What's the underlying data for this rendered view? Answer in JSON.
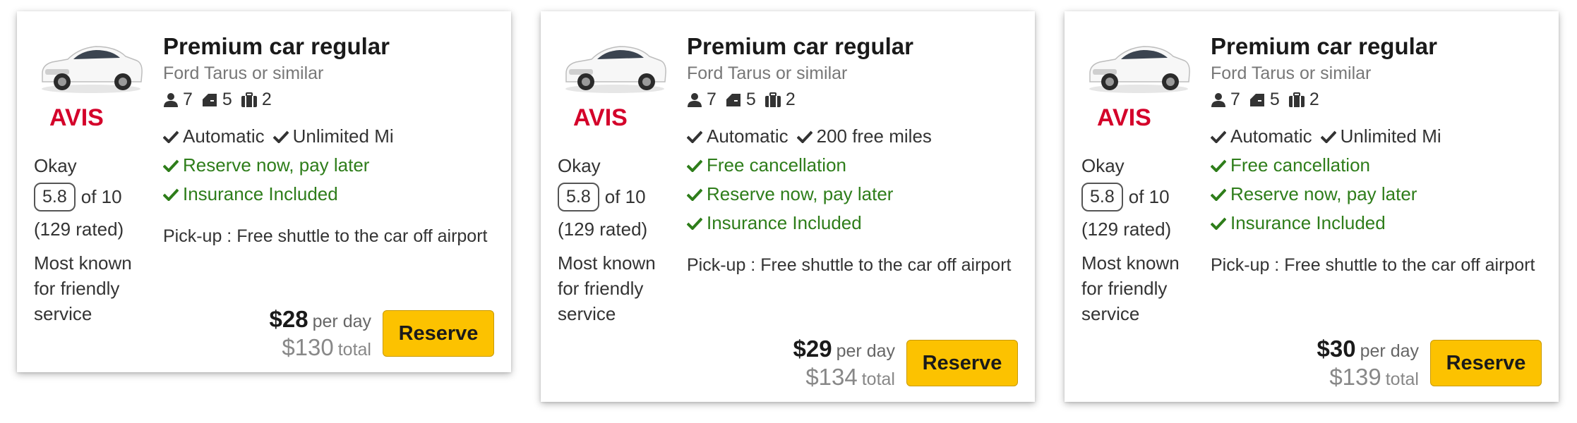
{
  "brand": {
    "logo_text": "AVIS",
    "logo_color": "#d4002a"
  },
  "colors": {
    "reserve_bg": "#fcc200",
    "green_text": "#2e7d1a"
  },
  "cards": [
    {
      "title": "Premium car regular",
      "subtitle": "Ford Tarus or similar",
      "specs": {
        "passengers": "7",
        "doors": "5",
        "bags": "2"
      },
      "features": [
        "Automatic",
        "Unlimited Mi"
      ],
      "green_features": [
        "Reserve now, pay later",
        "Insurance Included"
      ],
      "rating": {
        "word": "Okay",
        "score": "5.8",
        "out_of": "of 10",
        "rated": "(129 rated)",
        "known": "Most known for friendly service"
      },
      "pickup": "Pick-up : Free shuttle to the car off airport",
      "price": {
        "per_day": "$28",
        "per_day_label": "per day",
        "total": "$130",
        "total_label": "total"
      },
      "reserve_label": "Reserve"
    },
    {
      "title": "Premium car regular",
      "subtitle": "Ford Tarus or similar",
      "specs": {
        "passengers": "7",
        "doors": "5",
        "bags": "2"
      },
      "features": [
        "Automatic",
        "200 free miles"
      ],
      "green_features": [
        "Free cancellation",
        "Reserve now, pay later",
        "Insurance Included"
      ],
      "rating": {
        "word": "Okay",
        "score": "5.8",
        "out_of": "of 10",
        "rated": "(129 rated)",
        "known": "Most known for friendly service"
      },
      "pickup": "Pick-up : Free shuttle to the car off airport",
      "price": {
        "per_day": "$29",
        "per_day_label": "per day",
        "total": "$134",
        "total_label": "total"
      },
      "reserve_label": "Reserve"
    },
    {
      "title": "Premium car regular",
      "subtitle": "Ford Tarus or similar",
      "specs": {
        "passengers": "7",
        "doors": "5",
        "bags": "2"
      },
      "features": [
        "Automatic",
        "Unlimited Mi"
      ],
      "green_features": [
        "Free cancellation",
        "Reserve now, pay later",
        "Insurance Included"
      ],
      "rating": {
        "word": "Okay",
        "score": "5.8",
        "out_of": "of 10",
        "rated": "(129 rated)",
        "known": "Most known for friendly service"
      },
      "pickup": "Pick-up : Free shuttle to the car off airport",
      "price": {
        "per_day": "$30",
        "per_day_label": "per day",
        "total": "$139",
        "total_label": "total"
      },
      "reserve_label": "Reserve"
    }
  ]
}
